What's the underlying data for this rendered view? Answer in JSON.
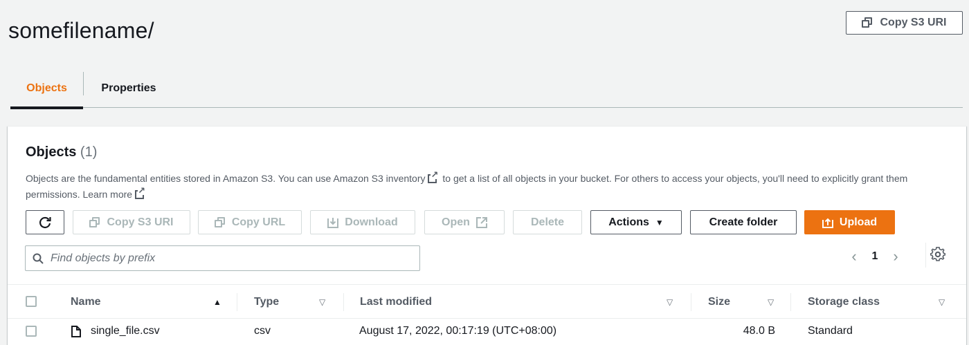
{
  "header": {
    "title": "somefilename/",
    "copy_s3_uri": "Copy S3 URI"
  },
  "tabs": [
    {
      "label": "Objects",
      "active": true
    },
    {
      "label": "Properties",
      "active": false
    }
  ],
  "objects_panel": {
    "title": "Objects",
    "count": "(1)",
    "description": {
      "part1": "Objects are the fundamental entities stored in Amazon S3. You can use ",
      "link_inventory": "Amazon S3 inventory",
      "part2": " to get a list of all objects in your bucket. For others to access your objects, you'll need to explicitly grant them permissions. ",
      "link_learn": "Learn more"
    },
    "toolbar": {
      "refresh_icon": "refresh-icon",
      "copy_s3_uri": "Copy S3 URI",
      "copy_url": "Copy URL",
      "download": "Download",
      "open": "Open",
      "delete": "Delete",
      "actions": "Actions",
      "create_folder": "Create folder",
      "upload": "Upload"
    },
    "search": {
      "placeholder": "Find objects by prefix",
      "value": ""
    },
    "pagination": {
      "current_page": "1"
    },
    "table": {
      "columns": [
        "Name",
        "Type",
        "Last modified",
        "Size",
        "Storage class"
      ],
      "rows": [
        {
          "name": "single_file.csv",
          "type": "csv",
          "last_modified": "August 17, 2022, 00:17:19 (UTC+08:00)",
          "size": "48.0 B",
          "storage_class": "Standard"
        }
      ]
    }
  },
  "colors": {
    "accent": "#ec7211",
    "text": "#16191f",
    "secondary_text": "#545b64",
    "disabled": "#aab7b8",
    "background": "#f2f3f3"
  }
}
